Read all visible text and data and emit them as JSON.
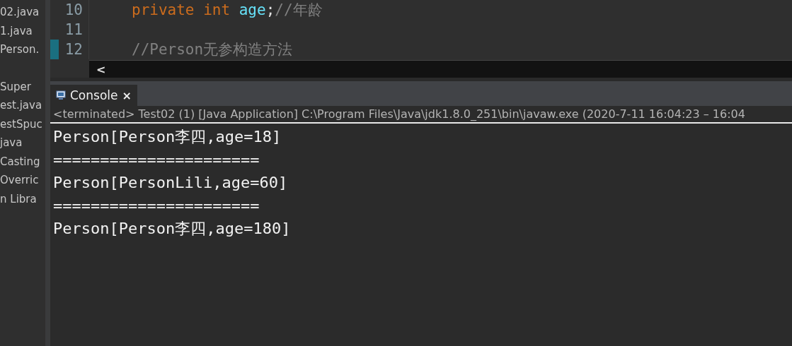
{
  "explorer": {
    "items": [
      "02.java",
      "1.java",
      "Person.",
      "Super",
      "est.java",
      "estSpuc",
      "java",
      "Casting",
      "Overric",
      "n Libra"
    ]
  },
  "editor": {
    "lines": [
      {
        "number": "10",
        "marked": false,
        "tokens": [
          {
            "kind": "keyword",
            "text": "private int "
          },
          {
            "kind": "field",
            "text": "age"
          },
          {
            "kind": "plain",
            "text": ";"
          },
          {
            "kind": "comment",
            "text": "//年龄"
          }
        ]
      },
      {
        "number": "11",
        "marked": false
      },
      {
        "number": "12",
        "marked": true,
        "tokens": [
          {
            "kind": "comment",
            "text": "//Person无参构造方法"
          }
        ]
      }
    ],
    "scroll_left": "<"
  },
  "console": {
    "tab": {
      "label": "Console",
      "close": "×",
      "selected": true
    },
    "status": "<terminated> Test02 (1) [Java Application] C:\\Program Files\\Java\\jdk1.8.0_251\\bin\\javaw.exe  (2020-7-11 16:04:23 – 16:04",
    "output": [
      "Person[Person李四,age=18]",
      "======================",
      "Person[PersonLili,age=60]",
      "======================",
      "Person[Person李四,age=180]"
    ]
  }
}
